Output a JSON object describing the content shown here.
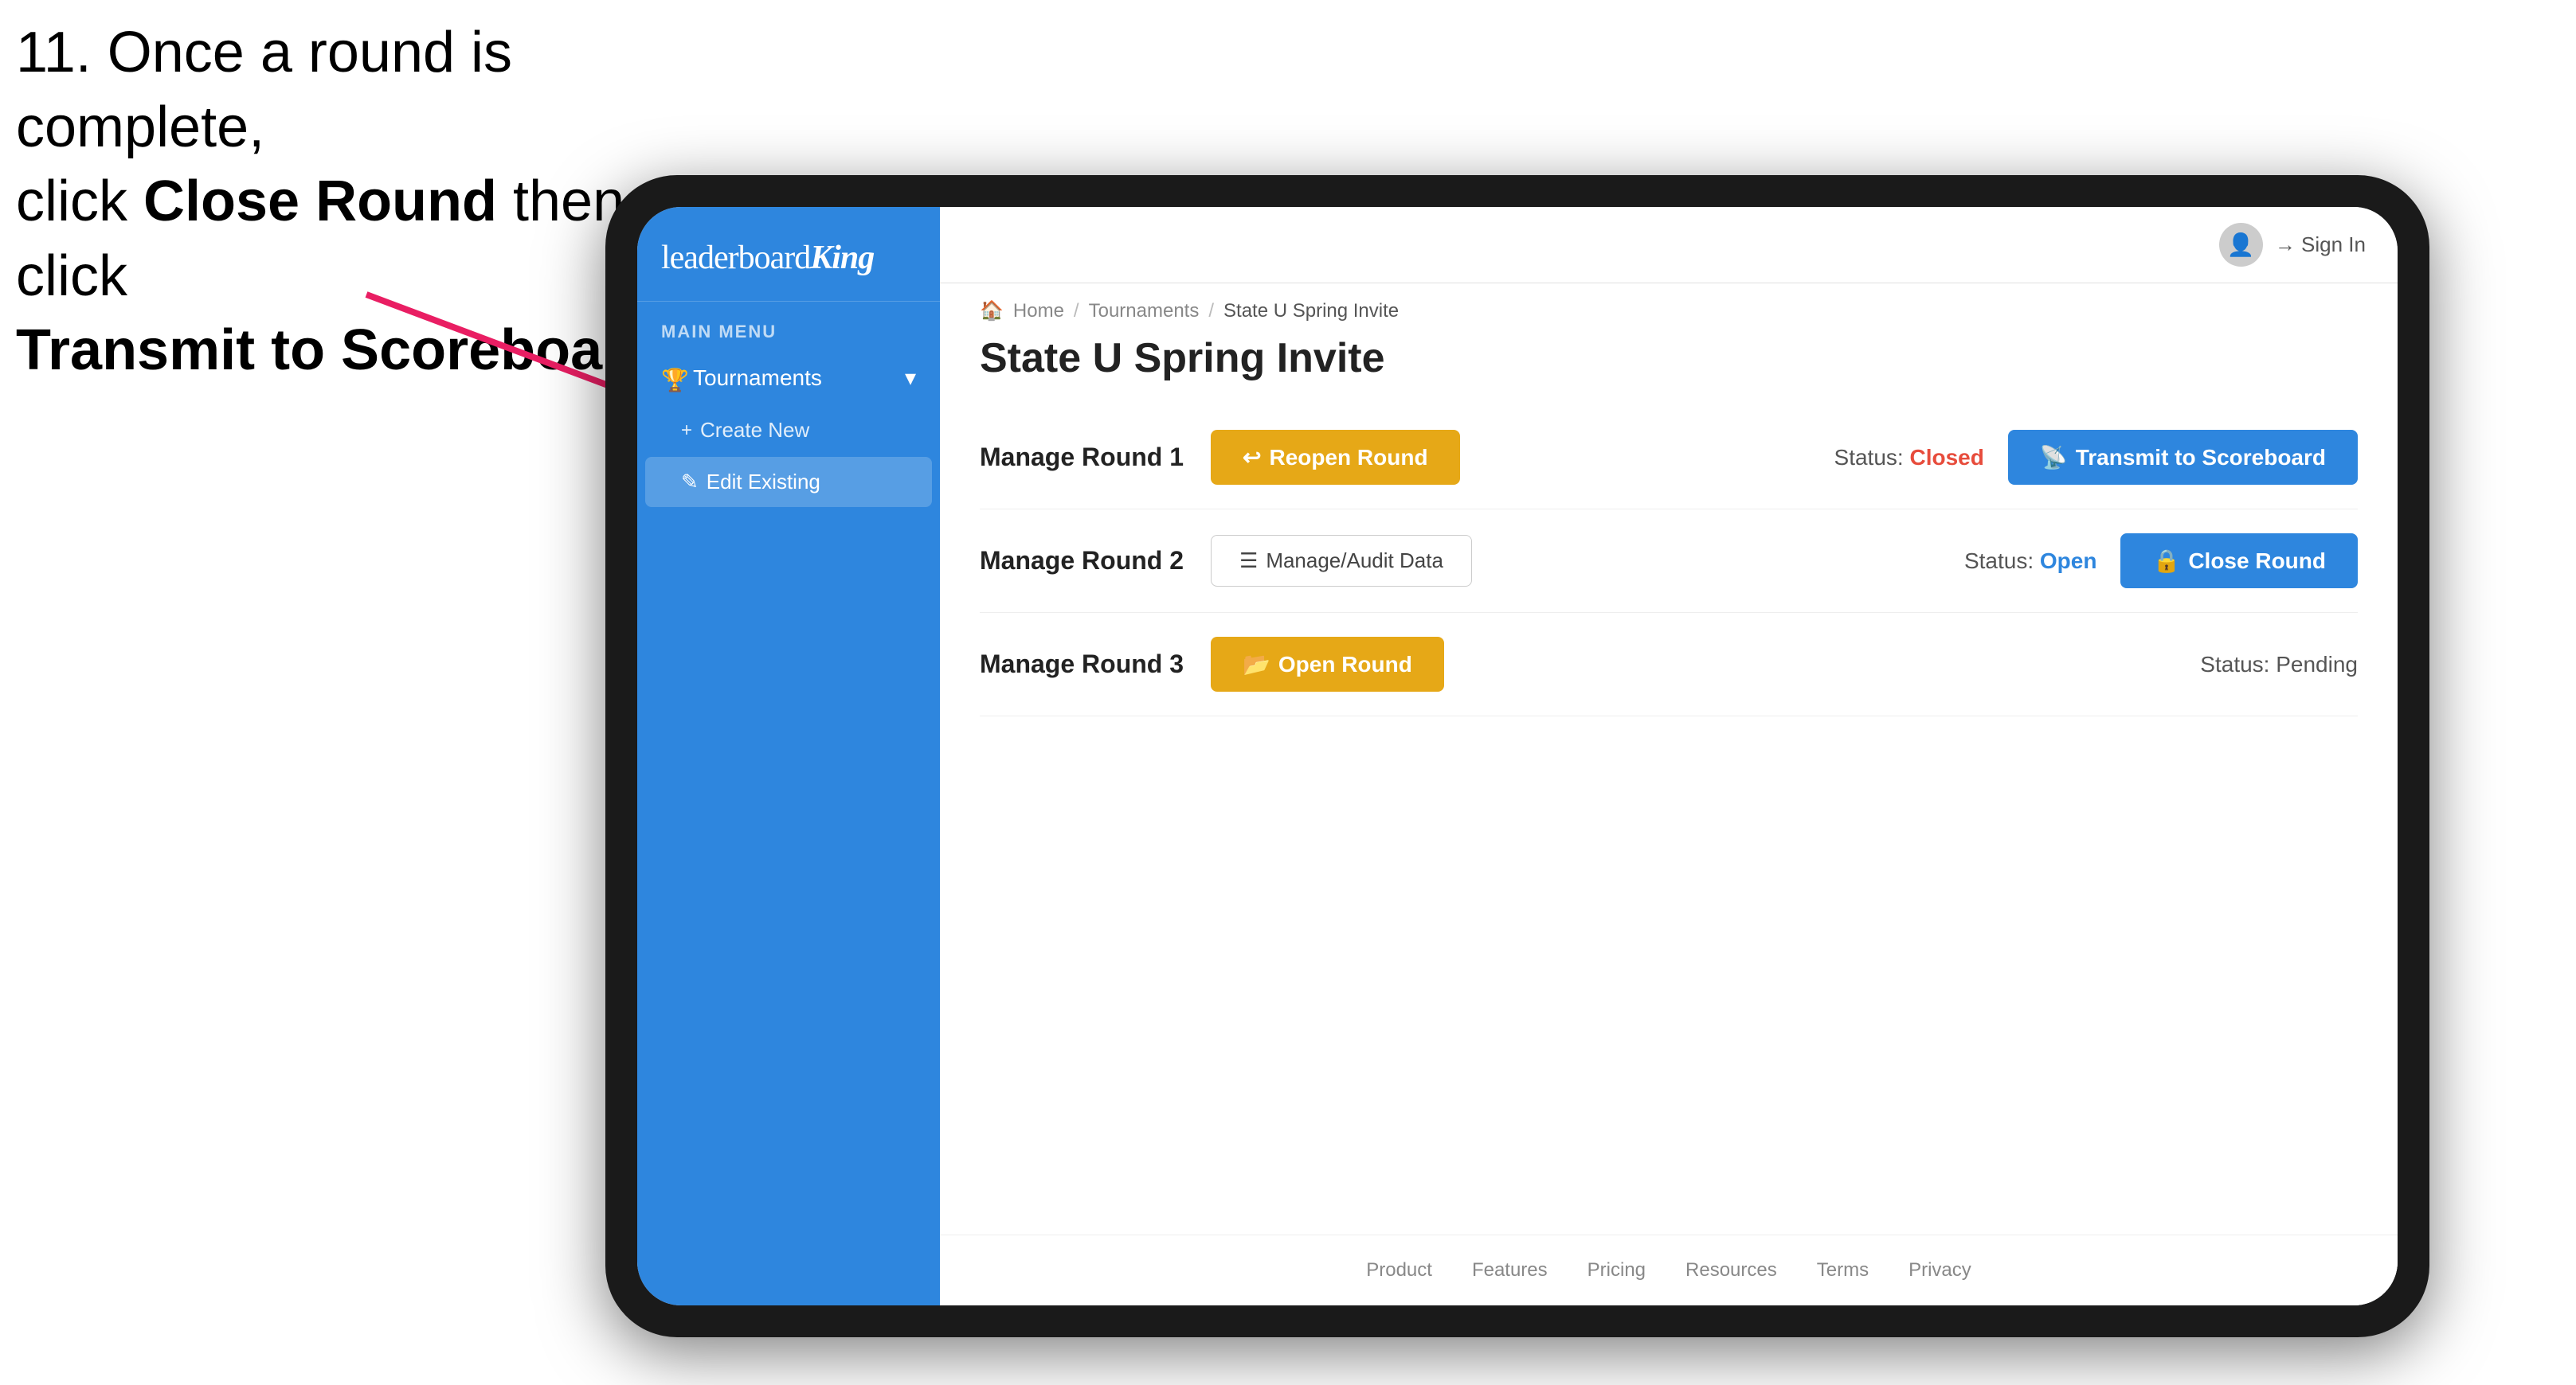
{
  "instruction": {
    "step": "11. Once a round is complete,",
    "line2_prefix": "click ",
    "line2_bold": "Close Round",
    "line2_suffix": " then click",
    "line3_bold": "Transmit to Scoreboard."
  },
  "sidebar": {
    "logo": "leaderboard",
    "logo_king": "King",
    "main_menu_label": "MAIN MENU",
    "nav_tournaments": "Tournaments",
    "nav_create_new": "Create New",
    "nav_edit_existing": "Edit Existing"
  },
  "topbar": {
    "sign_in": "Sign In"
  },
  "breadcrumb": {
    "home": "Home",
    "tournaments": "Tournaments",
    "current": "State U Spring Invite"
  },
  "page": {
    "title": "State U Spring Invite"
  },
  "rounds": [
    {
      "label": "Manage Round 1",
      "status_label": "Status:",
      "status_value": "Closed",
      "status_class": "status-closed",
      "btn_left_label": "Reopen Round",
      "btn_left_type": "reopen",
      "btn_right_label": "Transmit to Scoreboard",
      "btn_right_type": "transmit"
    },
    {
      "label": "Manage Round 2",
      "status_label": "Status:",
      "status_value": "Open",
      "status_class": "status-open",
      "btn_left_label": "Manage/Audit Data",
      "btn_left_type": "manage",
      "btn_right_label": "Close Round",
      "btn_right_type": "close"
    },
    {
      "label": "Manage Round 3",
      "status_label": "Status:",
      "status_value": "Pending",
      "status_class": "status-pending",
      "btn_left_label": "Open Round",
      "btn_left_type": "open",
      "btn_right_label": null,
      "btn_right_type": null
    }
  ],
  "footer": {
    "links": [
      "Product",
      "Features",
      "Pricing",
      "Resources",
      "Terms",
      "Privacy"
    ]
  },
  "colors": {
    "sidebar_blue": "#2e86de",
    "gold_button": "#e6a817",
    "close_red": "#e74c3c"
  }
}
